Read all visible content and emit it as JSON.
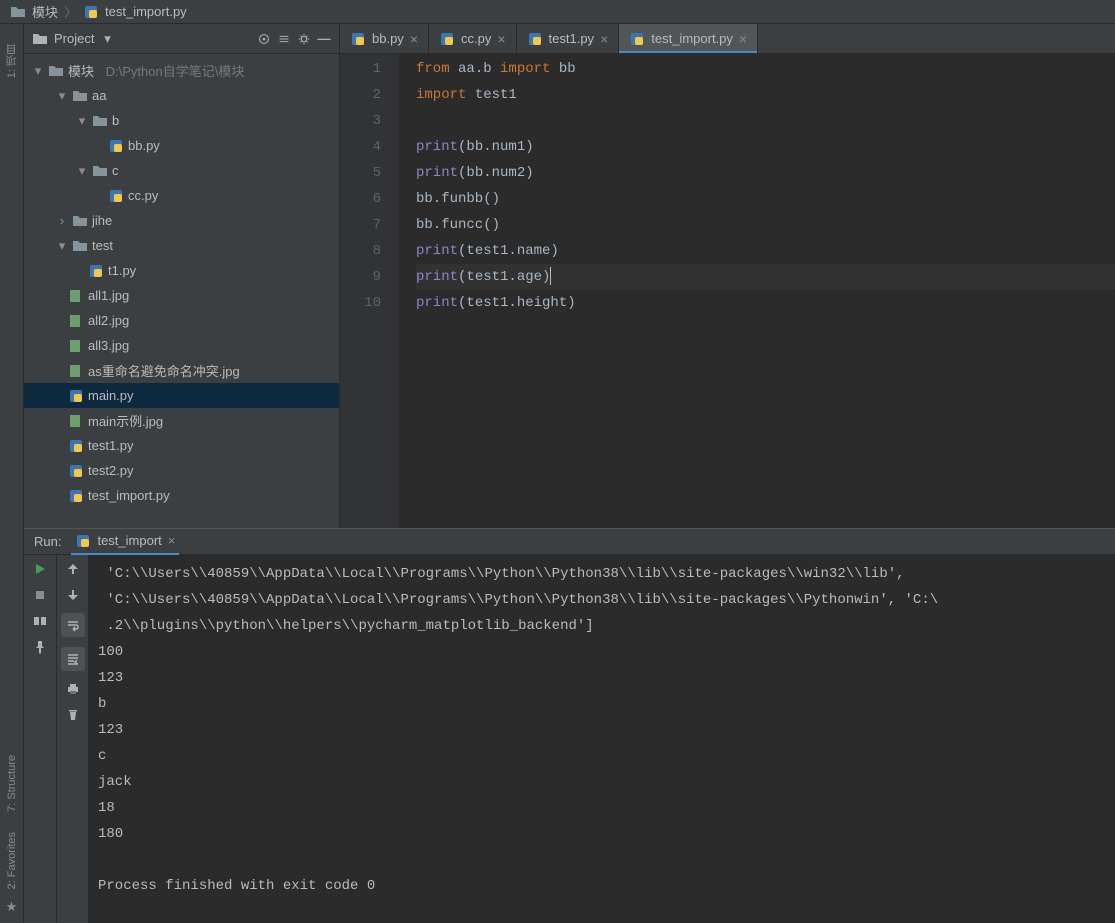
{
  "breadcrumb": {
    "root": "模块",
    "file": "test_import.py"
  },
  "sidebar": {
    "title": "Project",
    "root_label": "模块",
    "root_path": "D:\\Python自学笔记\\模块",
    "tree": {
      "aa": "aa",
      "b": "b",
      "bbpy": "bb.py",
      "c": "c",
      "ccpy": "cc.py",
      "jihe": "jihe",
      "test": "test",
      "t1py": "t1.py",
      "all1": "all1.jpg",
      "all2": "all2.jpg",
      "all3": "all3.jpg",
      "asjpg": "as重命名避免命名冲突.jpg",
      "mainpy": "main.py",
      "mainex": "main示例.jpg",
      "test1py": "test1.py",
      "test2py": "test2.py",
      "testimp": "test_import.py"
    }
  },
  "tabs": [
    {
      "label": "bb.py"
    },
    {
      "label": "cc.py"
    },
    {
      "label": "test1.py"
    },
    {
      "label": "test_import.py"
    }
  ],
  "code": {
    "l1": {
      "kw1": "from ",
      "m1": "aa.b ",
      "kw2": "import ",
      "m2": "bb"
    },
    "l2": {
      "kw": "import ",
      "m": "test1"
    },
    "l4": {
      "fn": "print",
      "arg": "(bb.num1)"
    },
    "l5": {
      "fn": "print",
      "arg": "(bb.num2)"
    },
    "l6": "bb.funbb()",
    "l7": "bb.funcc()",
    "l8": {
      "fn": "print",
      "arg": "(test1.name)"
    },
    "l9": {
      "fn": "print",
      "arg_open": "(",
      "arg_mid": "test1.age",
      "arg_close": ")"
    },
    "l10": {
      "fn": "print",
      "arg": "(test1.height)"
    }
  },
  "line_numbers": [
    "1",
    "2",
    "3",
    "4",
    "5",
    "6",
    "7",
    "8",
    "9",
    "10"
  ],
  "run": {
    "title": "Run:",
    "tab": "test_import",
    "console": " 'C:\\\\Users\\\\40859\\\\AppData\\\\Local\\\\Programs\\\\Python\\\\Python38\\\\lib\\\\site-packages\\\\win32\\\\lib',\n 'C:\\\\Users\\\\40859\\\\AppData\\\\Local\\\\Programs\\\\Python\\\\Python38\\\\lib\\\\site-packages\\\\Pythonwin', 'C:\\\n .2\\\\plugins\\\\python\\\\helpers\\\\pycharm_matplotlib_backend']\n100\n123\nb\n123\nc\njack\n18\n180\n\nProcess finished with exit code 0"
  },
  "left_bar": {
    "l1": "1: 项目",
    "l7": "7: Structure",
    "l2": "2: Favorites"
  }
}
